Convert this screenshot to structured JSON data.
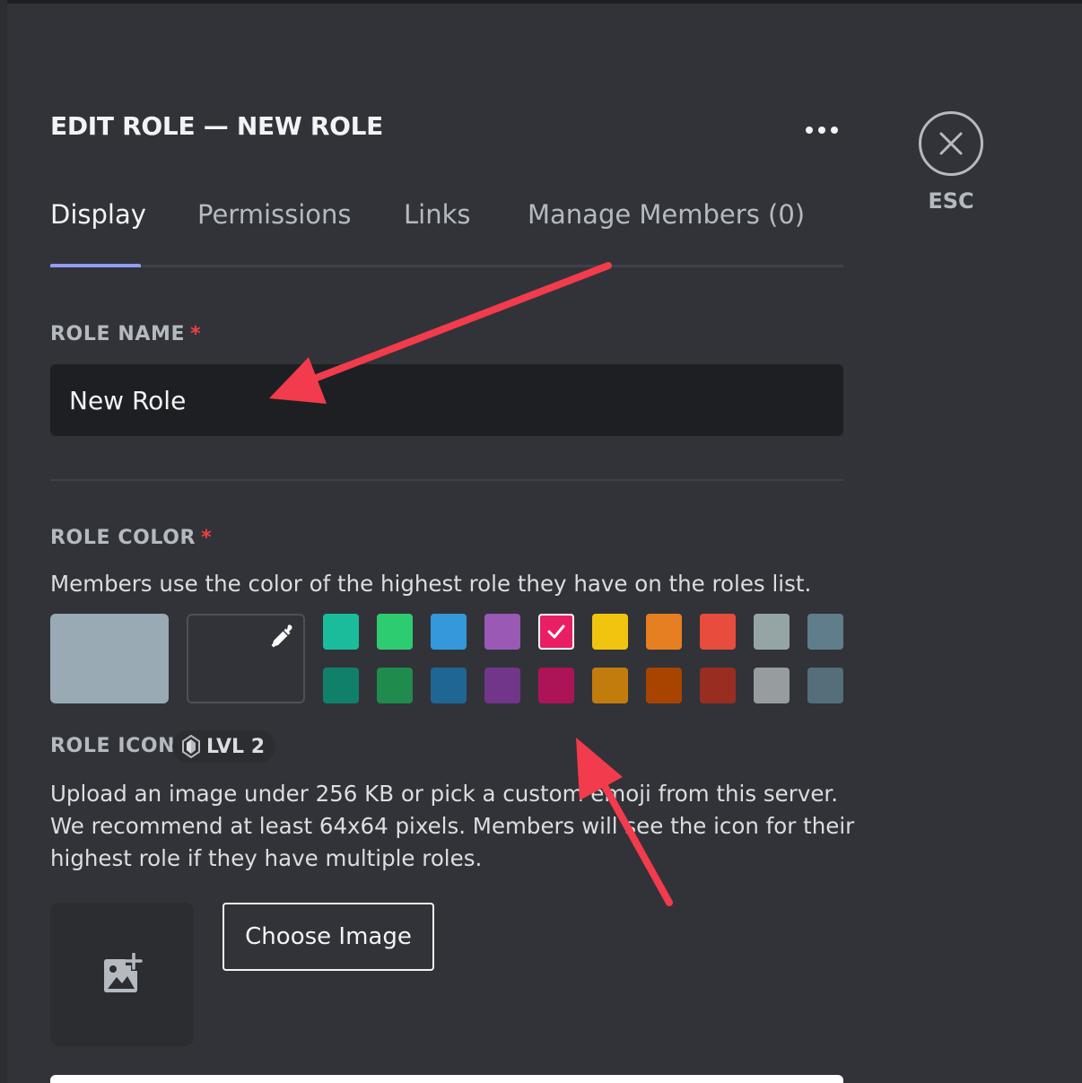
{
  "header": {
    "title": "EDIT ROLE — NEW ROLE",
    "more_icon": "ellipsis-icon",
    "close_icon": "close-x-icon",
    "esc_label": "ESC"
  },
  "tabs": [
    {
      "label": "Display",
      "active": true
    },
    {
      "label": "Permissions",
      "active": false
    },
    {
      "label": "Links",
      "active": false
    },
    {
      "label": "Manage Members (0)",
      "active": false
    }
  ],
  "role_name": {
    "label": "ROLE NAME",
    "required_mark": "*",
    "value": "New Role"
  },
  "role_color": {
    "label": "ROLE COLOR",
    "required_mark": "*",
    "description": "Members use the color of the highest role they have on the roles list.",
    "default_color": "#99aab5",
    "eyedropper_icon": "eyedropper-icon",
    "selected_index": 4,
    "palette_top": [
      "#1abc9c",
      "#2ecc71",
      "#3498db",
      "#9b59b6",
      "#e91e63",
      "#f1c40f",
      "#e67e22",
      "#e74c3c",
      "#95a5a6",
      "#607d8b"
    ],
    "palette_bottom": [
      "#11806a",
      "#1f8b4c",
      "#206694",
      "#71368a",
      "#ad1457",
      "#c27c0e",
      "#a84300",
      "#992d22",
      "#979c9f",
      "#546e7a"
    ]
  },
  "role_icon": {
    "label": "ROLE ICON",
    "badge_label": "LVL 2",
    "badge_icon": "boost-gem-icon",
    "description": "Upload an image under 256 KB or pick a custom emoji from this server. We recommend at least 64x64 pixels. Members will see the icon for their highest role if they have multiple roles.",
    "upload_icon": "add-image-icon",
    "choose_button": "Choose Image"
  },
  "colors": {
    "background": "#313338",
    "accent": "#949cf7",
    "required": "#f23f42",
    "annotation_arrow": "#f23b4c"
  }
}
